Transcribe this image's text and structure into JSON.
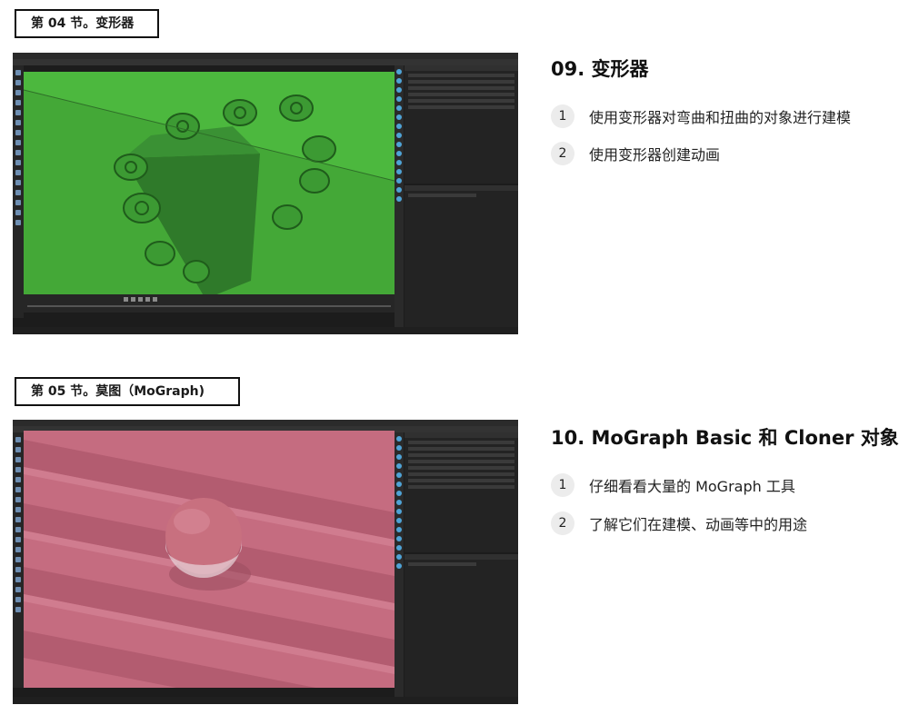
{
  "sections": [
    {
      "tag": "第 04 节。变形器",
      "course_title": "09. 变形器",
      "items": [
        {
          "num": "1",
          "text": "使用变形器对弯曲和扭曲的对象进行建模"
        },
        {
          "num": "2",
          "text": "使用变形器创建动画"
        }
      ],
      "scene_color": "#4cbb3f"
    },
    {
      "tag": "第 05 节。莫图（MoGraph)",
      "course_title": "10. MoGraph Basic 和 Cloner 对象",
      "items": [
        {
          "num": "1",
          "text": "仔细看看大量的 MoGraph 工具"
        },
        {
          "num": "2",
          "text": "了解它们在建模、动画等中的用途"
        }
      ],
      "scene_color": "#c76d82"
    }
  ]
}
